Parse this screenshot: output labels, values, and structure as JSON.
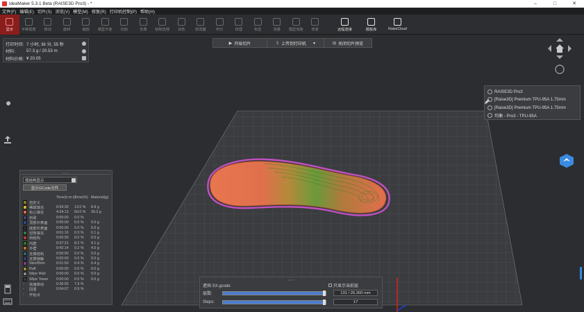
{
  "window": {
    "title": "ideaMaker 5.3.1 Beta (RAISE3D Pro3) - *",
    "controls": [
      "–",
      "□",
      "✕"
    ]
  },
  "menu": [
    "文件(F)",
    "编辑(E)",
    "切片(S)",
    "浏览(V)",
    "模型(M)",
    "修复(R)",
    "打印机控制(P)",
    "帮助(H)"
  ],
  "toolbar": [
    {
      "label": "显示",
      "icon": "eye-icon",
      "state": "active"
    },
    {
      "label": "平移视角",
      "icon": "pan-icon"
    },
    {
      "label": "移动",
      "icon": "move-icon"
    },
    {
      "label": "旋转",
      "icon": "rotate-icon"
    },
    {
      "label": "缩放",
      "icon": "scale-icon"
    },
    {
      "label": "模型平放",
      "icon": "lay-flat-icon"
    },
    {
      "label": "切割",
      "icon": "cut-icon"
    },
    {
      "label": "支撑",
      "icon": "support-icon"
    },
    {
      "label": "绘制支撑",
      "icon": "paint-support-icon"
    },
    {
      "label": "涂色",
      "icon": "color-icon"
    },
    {
      "label": "修改器",
      "icon": "modifier-icon"
    },
    {
      "label": "布尔",
      "icon": "boolean-icon"
    },
    {
      "label": "纹理",
      "icon": "texture-icon"
    },
    {
      "label": "标签",
      "icon": "label-icon"
    },
    {
      "label": "测量",
      "icon": "measure-icon"
    },
    {
      "label": "模型克隆",
      "icon": "clone-icon"
    },
    {
      "label": "修复",
      "icon": "repair-icon"
    },
    {
      "label": "远程连接",
      "icon": "remote-icon",
      "state": "bright"
    },
    {
      "label": "模板库",
      "icon": "template-icon",
      "state": "bright"
    },
    {
      "label": "RaiseCloud",
      "icon": "cloud-icon",
      "state": "bright"
    }
  ],
  "print_info": {
    "rows": [
      {
        "key": "打印时间:",
        "value": "7 小时, 36 分, 55 秒"
      },
      {
        "key": "材料:",
        "value": "57.3 g / 20.53 m"
      },
      {
        "key": "材料价格:",
        "value": "¥ 20.05"
      }
    ]
  },
  "slice_bar": {
    "start": "开始切片",
    "upload": "上传到打印机",
    "close": "关闭切片预览"
  },
  "printer_panel": {
    "items": [
      "RAISE3D Pro3",
      "[Raise3D] Premium TPU-95A 1.75mm",
      "[Raise3D] Premium TPU-95A 1.75mm",
      "均衡 - Pro3 - TPU-95A"
    ]
  },
  "legend": {
    "mode": "按结构显示",
    "gcode_button": "显示GCode文件",
    "headers": [
      "",
      "Time(h:m:s)",
      "Time(%)",
      "Material(g)"
    ],
    "rows": [
      {
        "name": "自定义",
        "time": "",
        "pct": "",
        "mat": "",
        "color": "#8a7a2a"
      },
      {
        "name": "稀疏填充",
        "time": "0:59:30",
        "pct": "13.0 %",
        "mat": "8.8 g",
        "color": "#d6b52a"
      },
      {
        "name": "实心填充",
        "time": "4:34:13",
        "pct": "60.0 %",
        "mat": "39.3 g",
        "color": "#e0684a"
      },
      {
        "name": "桥梁",
        "time": "0:00:00",
        "pct": "0.0 %",
        "mat": "",
        "color": "#3c4a7a"
      },
      {
        "name": "顶部外表面",
        "time": "0:00:00",
        "pct": "0.0 %",
        "mat": "0.0 g",
        "color": "#2a4a8a"
      },
      {
        "name": "底部外表面",
        "time": "0:00:00",
        "pct": "0.0 %",
        "mat": "0.0 g",
        "color": "#2a2a3a"
      },
      {
        "name": "空隙填充",
        "time": "0:01:16",
        "pct": "0.3 %",
        "mat": "0.1 g",
        "color": "#3a7a3a"
      },
      {
        "name": "桥结构",
        "time": "0:00:00",
        "pct": "0.0 %",
        "mat": "0.0 g",
        "color": "#b04040"
      },
      {
        "name": "内壁",
        "time": "0:37:31",
        "pct": "8.2 %",
        "mat": "4.1 g",
        "color": "#2a7a2a"
      },
      {
        "name": "外壁",
        "time": "0:42:14",
        "pct": "9.2 %",
        "mat": "4.5 g",
        "color": "#c07020"
      },
      {
        "name": "支撑结构",
        "time": "0:00:00",
        "pct": "0.0 %",
        "mat": "0.0 g",
        "color": "#2a6a6a"
      },
      {
        "name": "支撑接触",
        "time": "0:00:00",
        "pct": "0.0 %",
        "mat": "0.0 g",
        "color": "#3a3a7a"
      },
      {
        "name": "Skirt/Brim",
        "time": "0:01:59",
        "pct": "0.4 %",
        "mat": "0.4 g",
        "color": "#8a3a8a"
      },
      {
        "name": "Raft",
        "time": "0:00:00",
        "pct": "0.0 %",
        "mat": "0.0 g",
        "color": "#9a8a2a"
      },
      {
        "name": "Wipe Wall",
        "time": "0:00:00",
        "pct": "0.0 %",
        "mat": "0.0 g",
        "color": "#888888"
      },
      {
        "name": "Wipe Tower",
        "time": "0:00:00",
        "pct": "0.0 %",
        "mat": "0.0 g",
        "color": "#3a3a3a"
      },
      {
        "name": "快速移动",
        "time": "0:36:05",
        "pct": "7.9 %",
        "mat": "",
        "color": ""
      },
      {
        "name": "回退",
        "time": "0:04:07",
        "pct": "0.9 %",
        "mat": "",
        "color": ""
      },
      {
        "name": "开始点",
        "time": "",
        "pct": "",
        "mat": "",
        "color": ""
      }
    ]
  },
  "layers": {
    "file": "遮挡 SX.gcode",
    "only_current": "只显示当前层",
    "layer_label": "层数:",
    "layer_value": "131 / 26.300 mm",
    "steps_label": "Steps:",
    "steps_value": "17",
    "layer_fill": 1.0,
    "steps_fill": 1.0
  },
  "colors": {
    "accent": "#8b1d1d",
    "infill": "#e0684a",
    "wall": "#3a9a3a",
    "brim": "#c050c0"
  }
}
